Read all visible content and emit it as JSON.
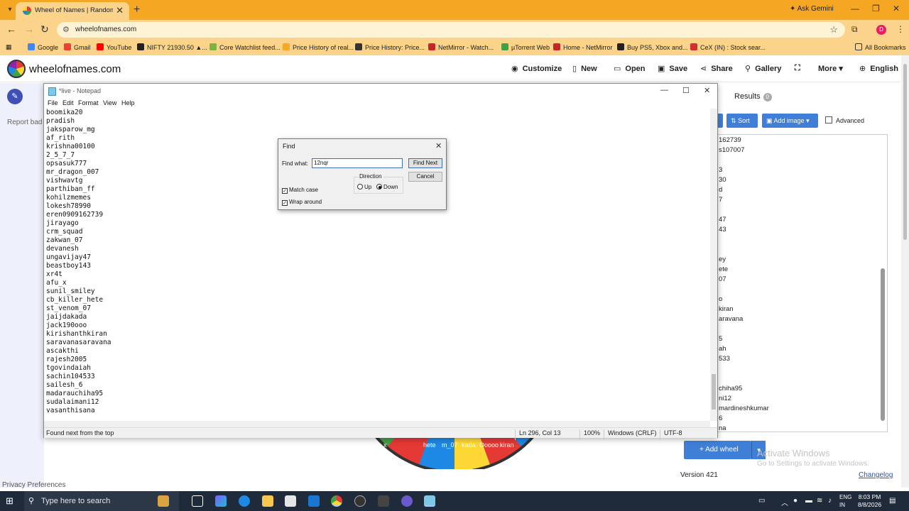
{
  "browser": {
    "tab_title": "Wheel of Names | Random nam",
    "ask_gemini": "Ask Gemini",
    "url": "wheelofnames.com",
    "profile_initial": "D",
    "bookmarks": [
      "Google",
      "Gmail",
      "YouTube",
      "NIFTY 21930.50 ▲...",
      "Core Watchlist feed...",
      "Price History of real...",
      "Price History: Price...",
      "NetMirror - Watch...",
      "µTorrent Web",
      "Home - NetMirror",
      "Buy PS5, Xbox and...",
      "CeX (IN) : Stock sear..."
    ],
    "all_bookmarks": "All Bookmarks"
  },
  "site": {
    "name": "wheelofnames.com",
    "nav": {
      "customize": "Customize",
      "new": "New",
      "open": "Open",
      "save": "Save",
      "share": "Share",
      "gallery": "Gallery",
      "more": "More",
      "language": "English"
    },
    "report_bad": "Report bad",
    "privacy": "Privacy Preferences",
    "wheel_labels": [
      "x",
      "hete",
      "Ooooo",
      "kada",
      "kiran",
      "m_07"
    ],
    "panel": {
      "results_label": "Results",
      "results_count": "0",
      "sort_label": "Sort",
      "add_image_label": "Add image",
      "advanced_label": "Advanced",
      "entries": [
        "162739",
        "s107007",
        "3",
        "30",
        "d",
        "7",
        "47",
        "43",
        "ey",
        "ete",
        "07",
        "o",
        "kiran",
        "aravana",
        "5",
        "ah",
        "533",
        "chiha95",
        "ni12",
        "mardineshkumar",
        "6",
        "na"
      ],
      "add_wheel": "Add wheel",
      "activate_title": "Activate Windows",
      "activate_sub": "Go to Settings to activate Windows.",
      "version": "Version 421",
      "changelog": "Changelog"
    }
  },
  "notepad": {
    "title": "*live - Notepad",
    "menu": [
      "File",
      "Edit",
      "Format",
      "View",
      "Help"
    ],
    "lines": [
      "boomika20",
      "pradish",
      "jaksparow_mg",
      "af_rith",
      "krishna00100",
      "2_5_7_7",
      "opsasuk777",
      "mr_dragon_007",
      "vishwavtg",
      "parthiban_ff",
      "kohilzmemes",
      "lokesh78990",
      "eren0909162739",
      "jirayago",
      "crm_squad",
      "zakwan_07",
      "devanesh",
      "ungavijay47",
      "beastboy143",
      "xr4t",
      "afu_x",
      "sunil_smiley",
      "cb_killer_hete",
      "st_venom_07",
      "jaijdakada",
      "jack190ooo",
      "kirishanthkiran",
      "saravanasaravana",
      "ascakthi",
      "rajesh2005",
      "tgovindaiah",
      "sachin104533",
      "sailesh_6",
      "madarauchiha95",
      "sudalaimani12",
      "vasanthisana"
    ],
    "status": {
      "message": "Found next from the top",
      "position": "Ln 296, Col 13",
      "zoom": "100%",
      "line_ending": "Windows (CRLF)",
      "encoding": "UTF-8"
    }
  },
  "find_dialog": {
    "title": "Find",
    "find_what_label": "Find what:",
    "find_what_value": "12nqr",
    "find_next": "Find Next",
    "cancel": "Cancel",
    "direction_label": "Direction",
    "up_label": "Up",
    "down_label": "Down",
    "direction_selected": "Down",
    "match_case_label": "Match case",
    "match_case": true,
    "wrap_around_label": "Wrap around",
    "wrap_around": true
  },
  "taskbar": {
    "search_placeholder": "Type here to search",
    "lang_line1": "ENG",
    "lang_line2": "IN",
    "time": "8:03 PM",
    "date": "8/8/2026"
  }
}
